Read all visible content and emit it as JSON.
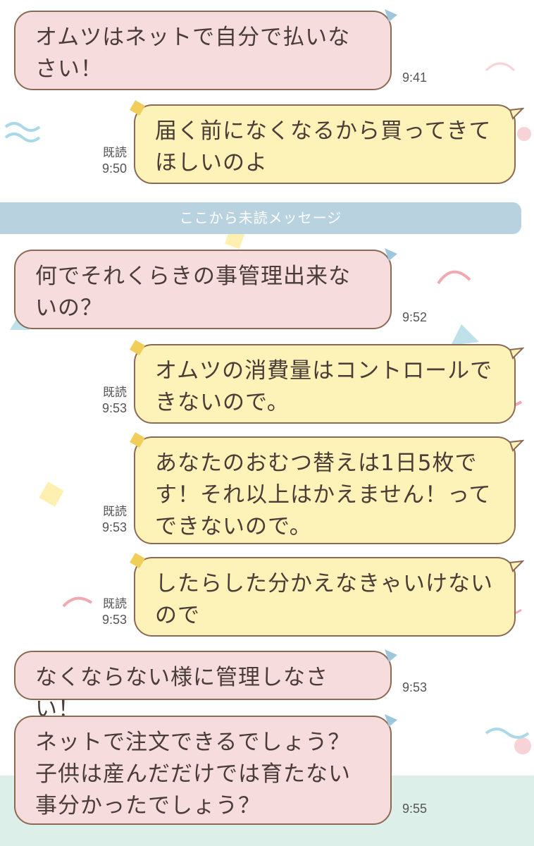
{
  "chat": {
    "unread_divider": "ここから未読メッセージ",
    "messages": [
      {
        "side": "in",
        "text": "オムツはネットで自分で払いなさい！",
        "time": "9:41"
      },
      {
        "side": "out",
        "text": "届く前になくなるから買ってきてほしいのよ",
        "read": "既読",
        "time": "9:50"
      },
      {
        "side": "in",
        "text": "何でそれくらきの事管理出来ないの？",
        "time": "9:52"
      },
      {
        "side": "out",
        "text": "オムツの消費量はコントロールできないので。",
        "read": "既読",
        "time": "9:53"
      },
      {
        "side": "out",
        "text": "あなたのおむつ替えは1日5枚です！それ以上はかえません！ってできないので。",
        "read": "既読",
        "time": "9:53"
      },
      {
        "side": "out",
        "text": "したらした分かえなきゃいけないので",
        "read": "既読",
        "time": "9:53"
      },
      {
        "side": "in",
        "text": "なくならない様に管理しなさい！",
        "time": "9:53"
      },
      {
        "side": "in",
        "text": "ネットで注文できるでしょう？子供は産んだだけでは育たない事分かったでしょう？",
        "time": "9:55"
      }
    ]
  },
  "colors": {
    "incoming_bubble": "#f7dcde",
    "outgoing_bubble": "#fdf2b7",
    "bubble_border": "#8a6a55",
    "divider": "#b9d2df"
  }
}
